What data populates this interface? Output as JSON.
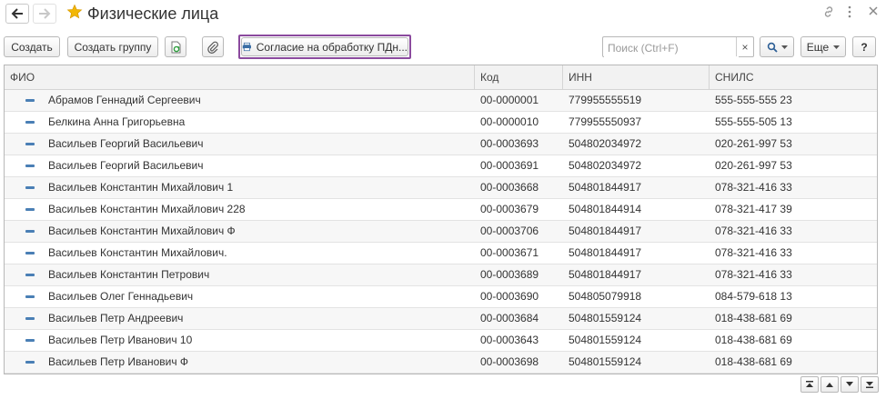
{
  "header": {
    "title": "Физические лица",
    "back_icon": "arrow-left-icon",
    "forward_icon": "arrow-right-icon",
    "favorite_icon": "star-icon",
    "link_icon": "link-icon",
    "menu_icon": "more-vertical-icon",
    "close_icon": "close-icon"
  },
  "toolbar": {
    "create_label": "Создать",
    "create_group_label": "Создать группу",
    "consent_label": "Согласие на обработку ПДн...",
    "search_placeholder": "Поиск (Ctrl+F)",
    "search_clear": "×",
    "more_label": "Еще",
    "help_label": "?"
  },
  "table": {
    "columns": [
      "ФИО",
      "Код",
      "ИНН",
      "СНИЛС"
    ],
    "rows": [
      [
        "Абрамов Геннадий Сергеевич",
        "00-0000001",
        "779955555519",
        "555-555-555 23"
      ],
      [
        "Белкина Анна Григорьевна",
        "00-0000010",
        "779955550937",
        "555-555-505 13"
      ],
      [
        "Васильев Георгий Васильевич",
        "00-0003693",
        "504802034972",
        "020-261-997 53"
      ],
      [
        "Васильев Георгий Васильевич",
        "00-0003691",
        "504802034972",
        "020-261-997 53"
      ],
      [
        "Васильев Константин Михайлович 1",
        "00-0003668",
        "504801844917",
        "078-321-416 33"
      ],
      [
        "Васильев Константин Михайлович 228",
        "00-0003679",
        "504801844914",
        "078-321-417 39"
      ],
      [
        "Васильев Константин Михайлович Ф",
        "00-0003706",
        "504801844917",
        "078-321-416 33"
      ],
      [
        "Васильев Константин Михайлович.",
        "00-0003671",
        "504801844917",
        "078-321-416 33"
      ],
      [
        "Васильев Константин Петрович",
        "00-0003689",
        "504801844917",
        "078-321-416 33"
      ],
      [
        "Васильев Олег Геннадьевич",
        "00-0003690",
        "504805079918",
        "084-579-618 13"
      ],
      [
        "Васильев Петр Андреевич",
        "00-0003684",
        "504801559124",
        "018-438-681 69"
      ],
      [
        "Васильев Петр Иванович 10",
        "00-0003643",
        "504801559124",
        "018-438-681 69"
      ],
      [
        "Васильев Петр Иванович Ф",
        "00-0003698",
        "504801559124",
        "018-438-681 69"
      ]
    ]
  },
  "colors": {
    "accent": "#8b4a9e",
    "star": "#f2b705",
    "row_icon": "#4a7fb5",
    "header_bg": "#f2f2f2"
  }
}
